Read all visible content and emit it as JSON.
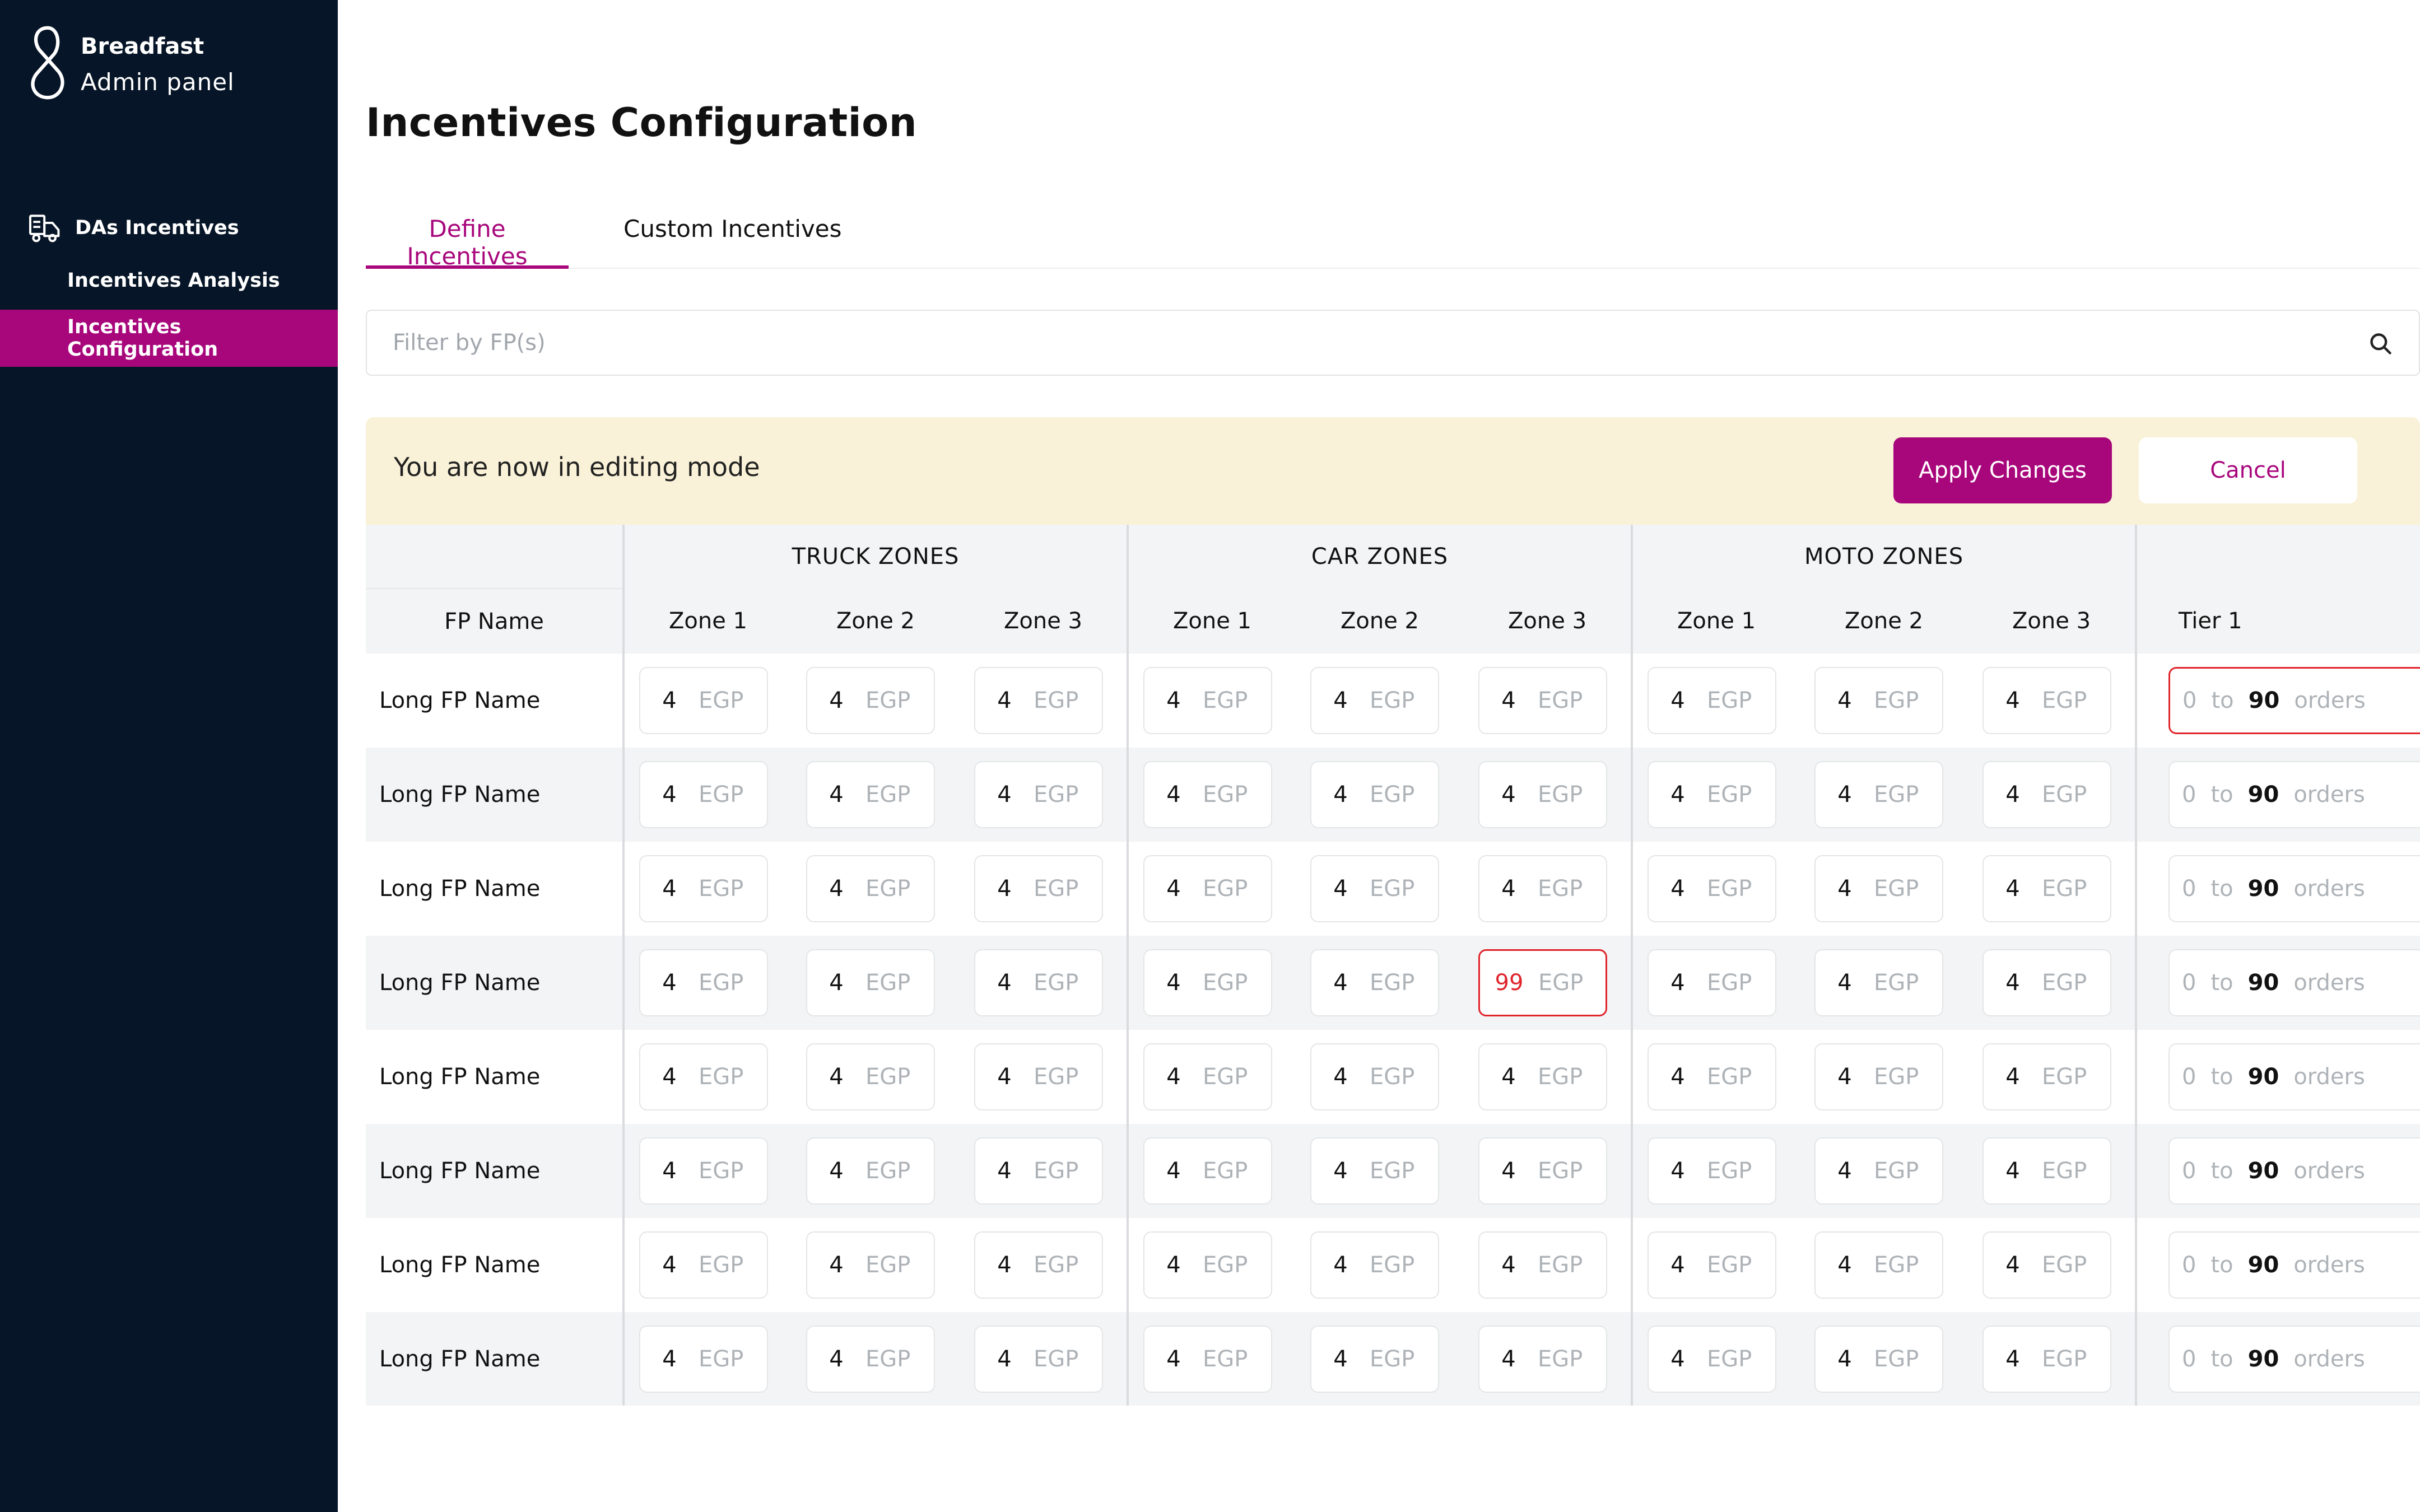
{
  "sidebar": {
    "brand_name": "Breadfast",
    "brand_sub": "Admin panel",
    "section_label": "DAs Incentives",
    "items": [
      {
        "label": "Incentives Analysis"
      },
      {
        "label": "Incentives Configuration"
      }
    ]
  },
  "page": {
    "title": "Incentives Configuration"
  },
  "tabs": [
    {
      "label": "Define Incentives"
    },
    {
      "label": "Custom Incentives"
    }
  ],
  "search": {
    "placeholder": "Filter by FP(s)",
    "value": ""
  },
  "edit_bar": {
    "message": "You are now in editing mode",
    "apply_label": "Apply Changes",
    "cancel_label": "Cancel"
  },
  "table": {
    "name_header": "FP Name",
    "groups": [
      "TRUCK ZONES",
      "CAR ZONES",
      "MOTO ZONES"
    ],
    "zone_labels": [
      "Zone 1",
      "Zone 2",
      "Zone 3",
      "Zone 1",
      "Zone 2",
      "Zone 3",
      "Zone 1",
      "Zone 2",
      "Zone 3"
    ],
    "tier_label": "Tier 1",
    "currency": "EGP",
    "tier_to": "to",
    "tier_unit": "orders",
    "rows": [
      {
        "name": "Long FP Name",
        "values": [
          "4",
          "4",
          "4",
          "4",
          "4",
          "4",
          "4",
          "4",
          "4"
        ],
        "tier_min": "0",
        "tier_max": "90",
        "error_cols": [],
        "tier_error": true
      },
      {
        "name": "Long FP Name",
        "values": [
          "4",
          "4",
          "4",
          "4",
          "4",
          "4",
          "4",
          "4",
          "4"
        ],
        "tier_min": "0",
        "tier_max": "90",
        "error_cols": [],
        "tier_error": false
      },
      {
        "name": "Long FP Name",
        "values": [
          "4",
          "4",
          "4",
          "4",
          "4",
          "4",
          "4",
          "4",
          "4"
        ],
        "tier_min": "0",
        "tier_max": "90",
        "error_cols": [],
        "tier_error": false
      },
      {
        "name": "Long FP Name",
        "values": [
          "4",
          "4",
          "4",
          "4",
          "4",
          "99",
          "4",
          "4",
          "4"
        ],
        "tier_min": "0",
        "tier_max": "90",
        "error_cols": [
          5
        ],
        "tier_error": false
      },
      {
        "name": "Long FP Name",
        "values": [
          "4",
          "4",
          "4",
          "4",
          "4",
          "4",
          "4",
          "4",
          "4"
        ],
        "tier_min": "0",
        "tier_max": "90",
        "error_cols": [],
        "tier_error": false
      },
      {
        "name": "Long FP Name",
        "values": [
          "4",
          "4",
          "4",
          "4",
          "4",
          "4",
          "4",
          "4",
          "4"
        ],
        "tier_min": "0",
        "tier_max": "90",
        "error_cols": [],
        "tier_error": false
      },
      {
        "name": "Long FP Name",
        "values": [
          "4",
          "4",
          "4",
          "4",
          "4",
          "4",
          "4",
          "4",
          "4"
        ],
        "tier_min": "0",
        "tier_max": "90",
        "error_cols": [],
        "tier_error": false
      },
      {
        "name": "Long FP Name",
        "values": [
          "4",
          "4",
          "4",
          "4",
          "4",
          "4",
          "4",
          "4",
          "4"
        ],
        "tier_min": "0",
        "tier_max": "90",
        "error_cols": [],
        "tier_error": false
      }
    ]
  },
  "colors": {
    "accent": "#A8077C",
    "sidebar_bg": "#061527",
    "edit_bar_bg": "#FAF2D8",
    "error": "#E0242C"
  },
  "icons": {
    "brand": "breadfast-logo-icon",
    "section": "delivery-truck-icon",
    "search": "search-icon"
  }
}
